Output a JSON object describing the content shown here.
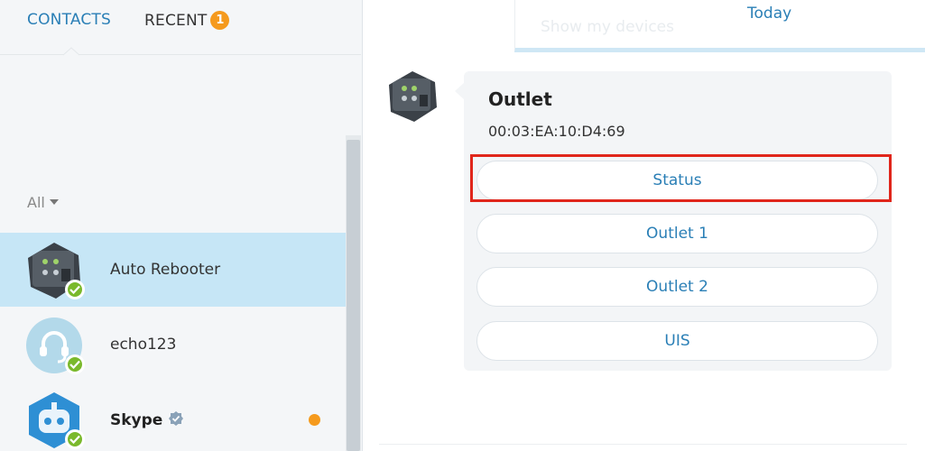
{
  "left": {
    "tabs": [
      {
        "label": "CONTACTS",
        "active": true
      },
      {
        "label": "RECENT",
        "badge": "1"
      }
    ],
    "filter_label": "All",
    "contacts": [
      {
        "name": "Auto Rebooter",
        "status": "online",
        "selected": true,
        "avatar_label": "Auto Rebooter"
      },
      {
        "name": "echo123",
        "status": "online",
        "selected": false
      },
      {
        "name": "Skype",
        "status": "online",
        "verified": true,
        "unread": true,
        "selected": false
      }
    ]
  },
  "right": {
    "devices_placeholder": "Show my devices",
    "date_label": "Today",
    "card": {
      "title": "Outlet",
      "subtitle": "00:03:EA:10:D4:69",
      "buttons": [
        "Status",
        "Outlet 1",
        "Outlet 2",
        "UIS"
      ]
    }
  },
  "colors": {
    "accent": "#2a7fb6",
    "badge": "#f59a1d",
    "online": "#7ab92c",
    "selected_row": "#c6e6f6",
    "highlight": "#e0261b"
  }
}
